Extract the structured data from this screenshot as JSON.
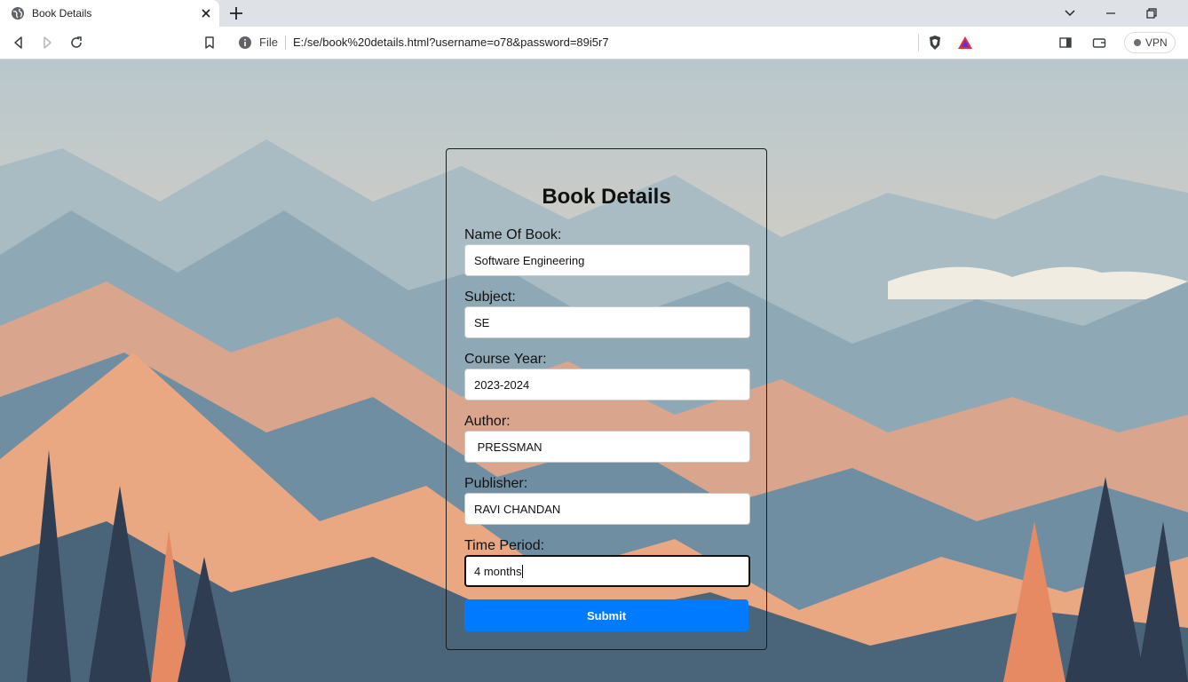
{
  "browser": {
    "tab": {
      "title": "Book Details"
    },
    "address_bar": {
      "scheme_label": "File",
      "url": "E:/se/book%20details.html?username=o78&password=89i5r7"
    },
    "vpn_label": "VPN"
  },
  "form": {
    "title": "Book Details",
    "fields": [
      {
        "label": "Name Of Book:",
        "value": "Software Engineering"
      },
      {
        "label": "Subject:",
        "value": "SE"
      },
      {
        "label": "Course Year:",
        "value": "2023-2024"
      },
      {
        "label": "Author:",
        "value": " PRESSMAN"
      },
      {
        "label": "Publisher:",
        "value": "RAVI CHANDAN"
      },
      {
        "label": "Time Period:",
        "value": "4 months"
      }
    ],
    "submit_label": "Submit"
  },
  "colors": {
    "accent": "#007bff",
    "chrome_background": "#dee1e6"
  }
}
